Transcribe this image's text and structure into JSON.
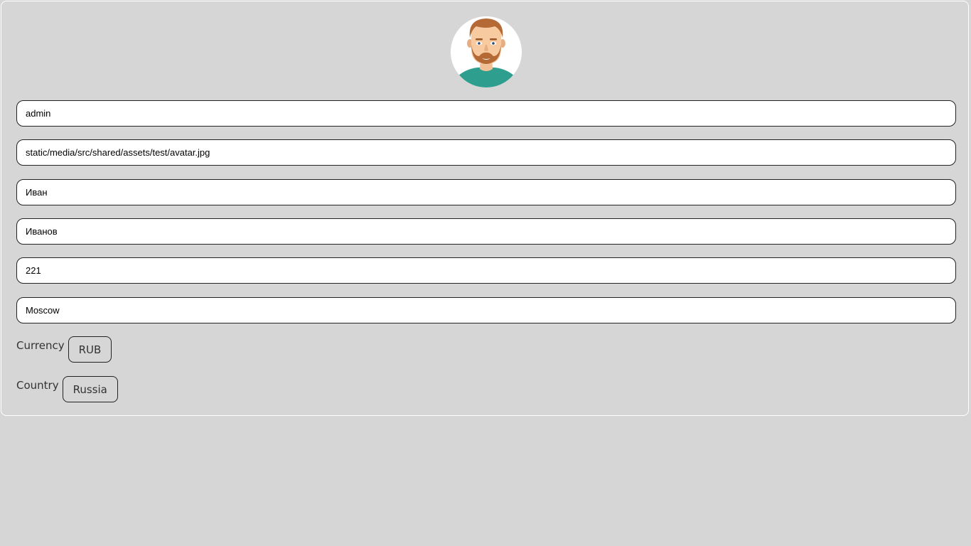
{
  "profile": {
    "login": "admin",
    "avatar_path": "static/media/src/shared/assets/test/avatar.jpg",
    "first_name": "Иван",
    "last_name": "Иванов",
    "age": "221",
    "city": "Moscow"
  },
  "currency": {
    "label": "Currency",
    "value": "RUB"
  },
  "country": {
    "label": "Country",
    "value": "Russia"
  },
  "colors": {
    "background": "#d6d6d6",
    "card_border": "#ffffff",
    "field_border": "#222222",
    "avatar_shirt": "#2e9e8e",
    "avatar_hair": "#b56a35"
  }
}
